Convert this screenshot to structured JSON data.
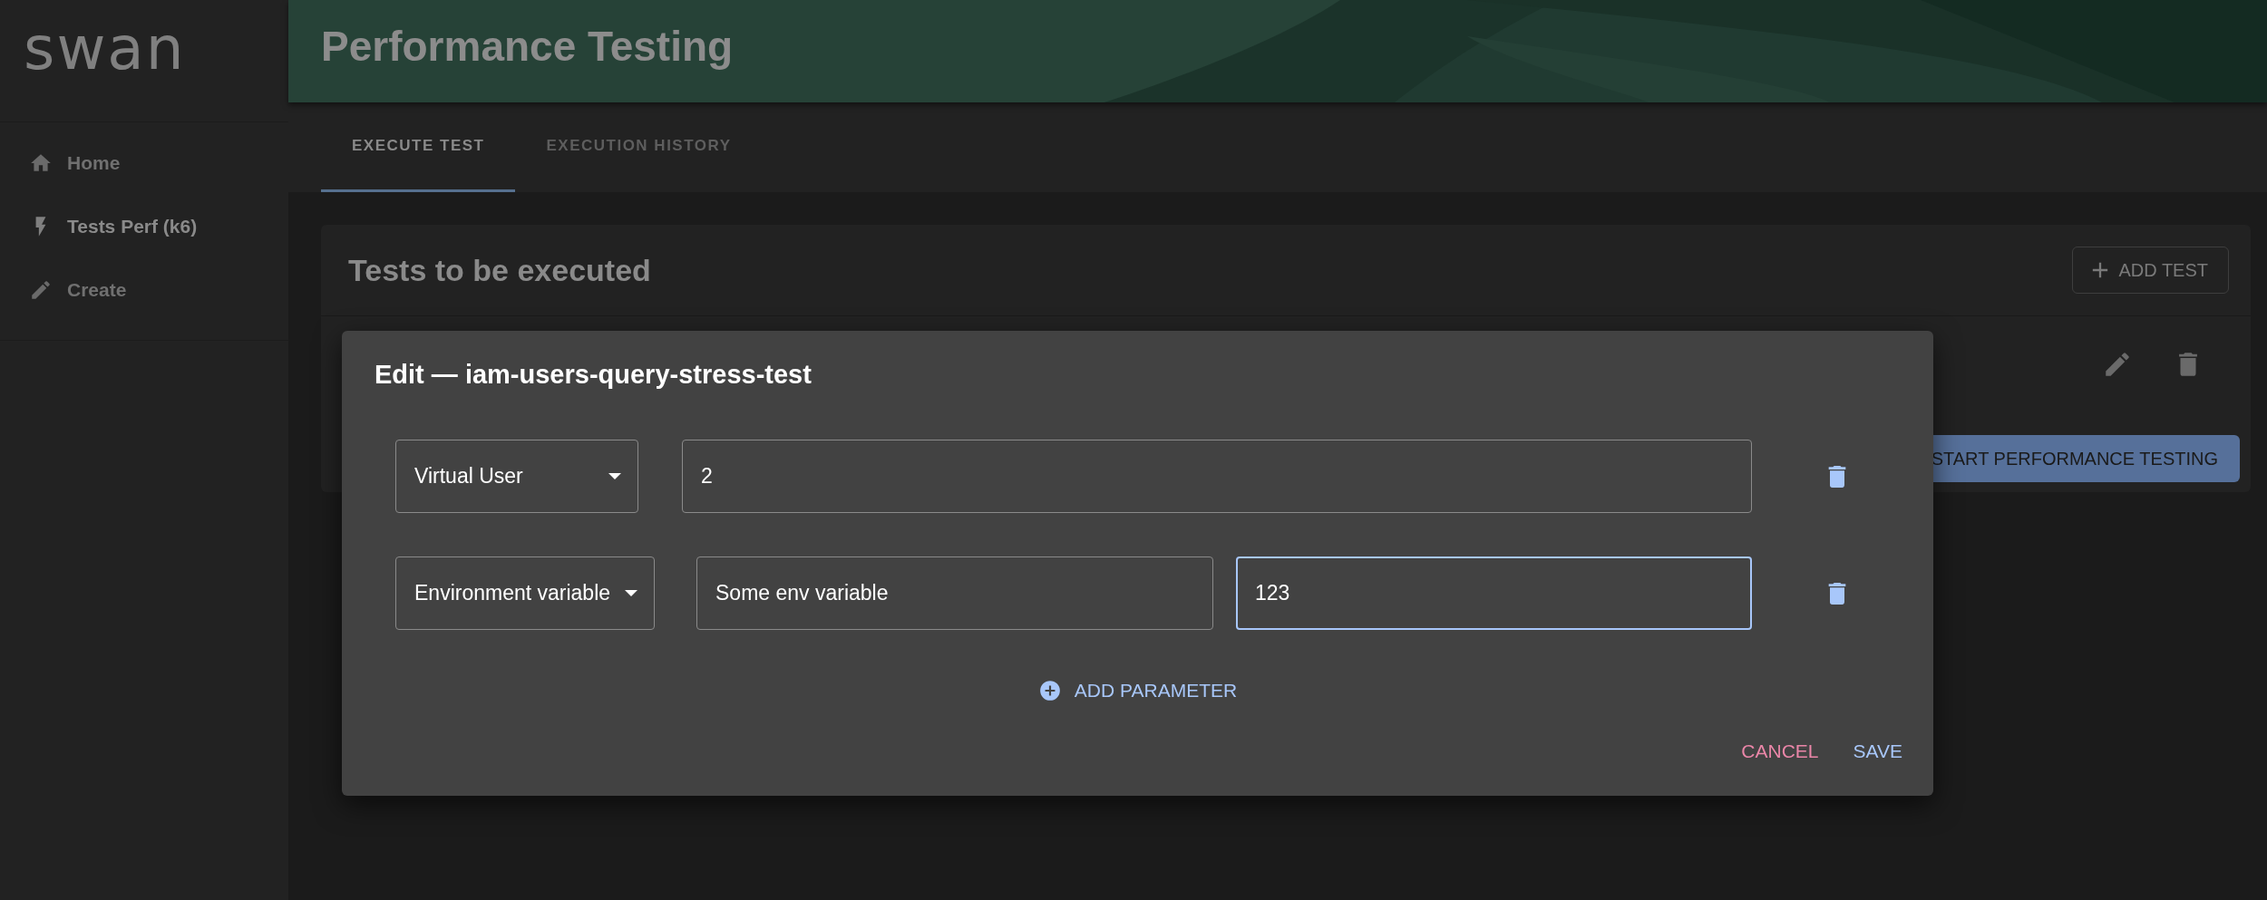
{
  "app": {
    "logo": "swan"
  },
  "header": {
    "title": "Performance Testing"
  },
  "sidebar": {
    "items": [
      {
        "label": "Home",
        "selected": false
      },
      {
        "label": "Tests Perf (k6)",
        "selected": true
      },
      {
        "label": "Create",
        "selected": false
      }
    ]
  },
  "tabs": [
    {
      "label": "EXECUTE TEST",
      "selected": true
    },
    {
      "label": "EXECUTION HISTORY",
      "selected": false
    }
  ],
  "card": {
    "title": "Tests to be executed",
    "add_button": "ADD TEST",
    "start_button": "START PERFORMANCE TESTING"
  },
  "dialog": {
    "title": "Edit — iam-users-query-stress-test",
    "parameters": [
      {
        "kind": "single",
        "type": "Virtual User",
        "fields": [
          {
            "value": "2",
            "focused": false
          }
        ]
      },
      {
        "kind": "pair",
        "type": "Environment variable",
        "fields": [
          {
            "value": "Some env variable",
            "focused": false
          },
          {
            "value": "123",
            "focused": true
          }
        ]
      }
    ],
    "add_parameter": "ADD PARAMETER",
    "cancel": "CANCEL",
    "save": "SAVE"
  }
}
